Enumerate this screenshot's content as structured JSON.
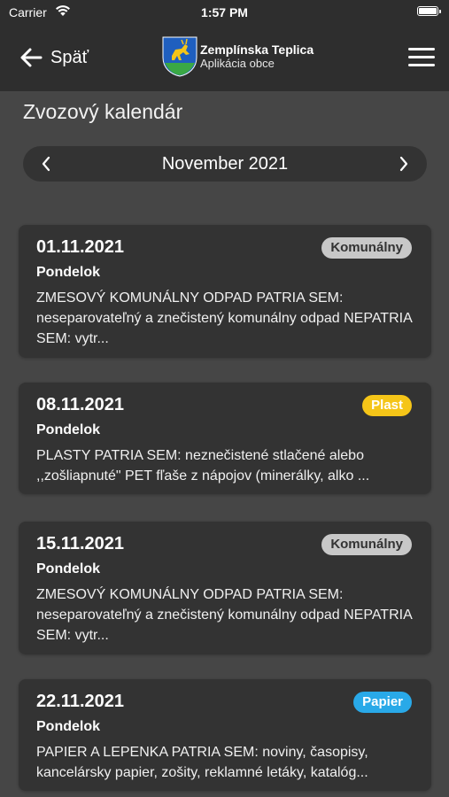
{
  "status_bar": {
    "carrier": "Carrier",
    "time": "1:57 PM"
  },
  "header": {
    "back_label": "Späť",
    "app_title": "Zemplínska Teplica",
    "app_subtitle": "Aplikácia obce"
  },
  "page": {
    "title": "Zvozový kalendár"
  },
  "month_nav": {
    "label": "November 2021"
  },
  "colors": {
    "background": "#464646",
    "header": "#2e2e2e",
    "card": "#333333",
    "badge_komunalny": "#c8c8c8",
    "badge_plast": "#f5c518",
    "badge_papier": "#29a9e8"
  },
  "events": [
    {
      "date": "01.11.2021",
      "day": "Pondelok",
      "badge": "Komunálny",
      "description": "ZMESOVÝ KOMUNÁLNY ODPAD PATRIA SEM: neseparovateľný a znečistený komunálny odpad NEPATRIA SEM: vytr..."
    },
    {
      "date": "08.11.2021",
      "day": "Pondelok",
      "badge": "Plast",
      "description": "PLASTY PATRIA SEM: neznečistené stlačené alebo ,,zošliapnuté\" PET fľaše z nápojov (minerálky, alko ..."
    },
    {
      "date": "15.11.2021",
      "day": "Pondelok",
      "badge": "Komunálny",
      "description": "ZMESOVÝ KOMUNÁLNY ODPAD PATRIA SEM: neseparovateľný a znečistený komunálny odpad NEPATRIA SEM: vytr..."
    },
    {
      "date": "22.11.2021",
      "day": "Pondelok",
      "badge": "Papier",
      "description": "PAPIER A LEPENKA PATRIA SEM: noviny, časopisy, kancelársky papier, zošity, reklamné letáky, katalóg..."
    }
  ]
}
